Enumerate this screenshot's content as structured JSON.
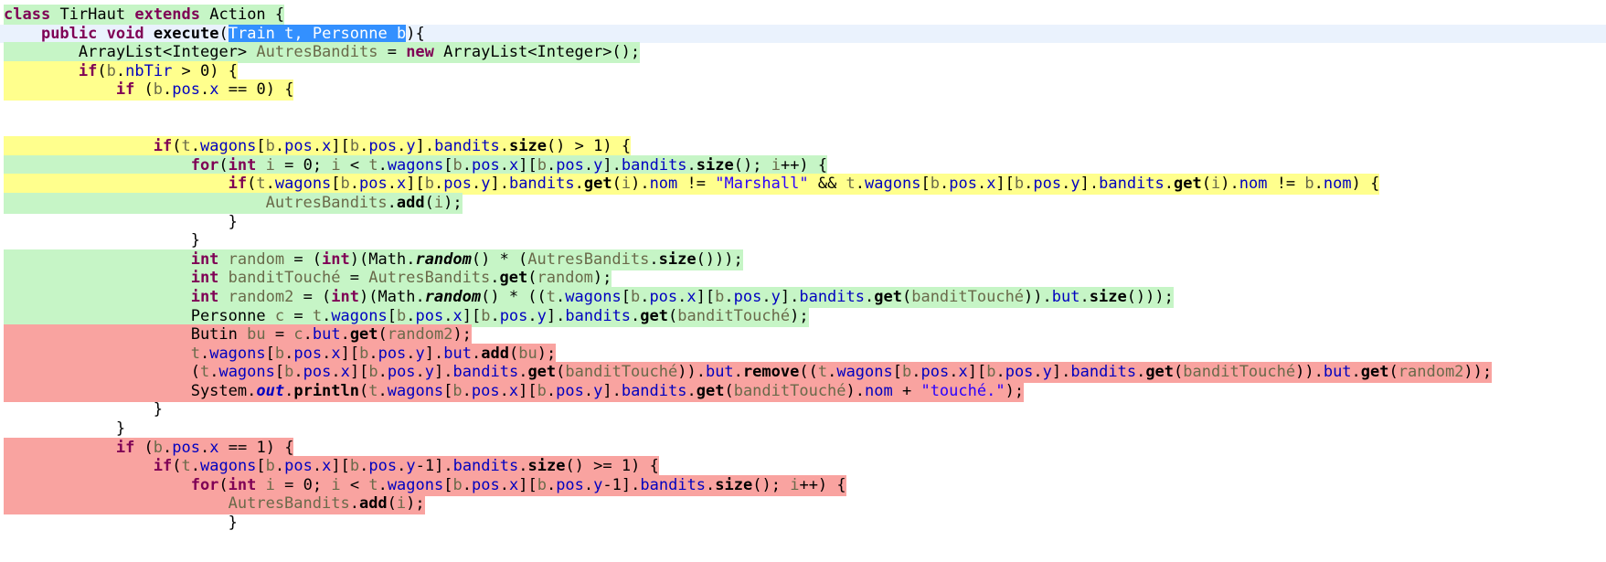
{
  "editor": {
    "language": "java",
    "font_size_px": 17,
    "line_height_px": 20.6,
    "background": "#ffffff",
    "colors": {
      "keyword": "#7f0055",
      "string": "#2a00ff",
      "field": "#0000c0",
      "method": "#000000",
      "identifier": "#6a6a4a",
      "plain": "#000000",
      "selection_bg": "#3390ff",
      "selection_fg": "#ffffff",
      "current_line_bg": "#eaf2fd",
      "coverage_full": "#c6f5c6",
      "coverage_partial": "#ffff8d",
      "coverage_none": "#f9a3a0"
    },
    "selection_text": "Train t, Personne b"
  },
  "code": {
    "class_name": "TirHaut",
    "super_class": "Action",
    "method_name": "execute",
    "lines": [
      {
        "n": 1,
        "indent": 0,
        "highlight": "green",
        "text": "class TirHaut extends Action {"
      },
      {
        "n": 2,
        "indent": 1,
        "highlight": "none",
        "current": true,
        "text": "public void execute(Train t, Personne b){"
      },
      {
        "n": 3,
        "indent": 2,
        "highlight": "green",
        "text": "ArrayList<Integer> AutresBandits = new ArrayList<Integer>();"
      },
      {
        "n": 4,
        "indent": 2,
        "highlight": "yellow",
        "text": "if(b.nbTir > 0) {"
      },
      {
        "n": 5,
        "indent": 3,
        "highlight": "yellow",
        "text": "if (b.pos.x == 0) {"
      },
      {
        "n": 6,
        "indent": 0,
        "highlight": "none",
        "text": ""
      },
      {
        "n": 7,
        "indent": 0,
        "highlight": "none",
        "text": ""
      },
      {
        "n": 8,
        "indent": 4,
        "highlight": "yellow",
        "text": "if(t.wagons[b.pos.x][b.pos.y].bandits.size() > 1) {"
      },
      {
        "n": 9,
        "indent": 5,
        "highlight": "green",
        "text": "for(int i = 0; i < t.wagons[b.pos.x][b.pos.y].bandits.size(); i++) {"
      },
      {
        "n": 10,
        "indent": 6,
        "highlight": "yellow",
        "text": "if(t.wagons[b.pos.x][b.pos.y].bandits.get(i).nom != \"Marshall\" && t.wagons[b.pos.x][b.pos.y].bandits.get(i).nom != b.nom) {"
      },
      {
        "n": 11,
        "indent": 7,
        "highlight": "green",
        "text": "AutresBandits.add(i);"
      },
      {
        "n": 12,
        "indent": 6,
        "highlight": "none",
        "text": "}"
      },
      {
        "n": 13,
        "indent": 5,
        "highlight": "none",
        "text": "}"
      },
      {
        "n": 14,
        "indent": 5,
        "highlight": "green",
        "text": "int random = (int)(Math.random() * (AutresBandits.size()));"
      },
      {
        "n": 15,
        "indent": 5,
        "highlight": "green",
        "text": "int banditTouché = AutresBandits.get(random);"
      },
      {
        "n": 16,
        "indent": 5,
        "highlight": "green",
        "text": "int random2 = (int)(Math.random() * ((t.wagons[b.pos.x][b.pos.y].bandits.get(banditTouché)).but.size()));"
      },
      {
        "n": 17,
        "indent": 5,
        "highlight": "green",
        "text": "Personne c = t.wagons[b.pos.x][b.pos.y].bandits.get(banditTouché);"
      },
      {
        "n": 18,
        "indent": 5,
        "highlight": "red",
        "text": "Butin bu = c.but.get(random2);"
      },
      {
        "n": 19,
        "indent": 5,
        "highlight": "red",
        "text": "t.wagons[b.pos.x][b.pos.y].but.add(bu);"
      },
      {
        "n": 20,
        "indent": 5,
        "highlight": "red",
        "text": "(t.wagons[b.pos.x][b.pos.y].bandits.get(banditTouché)).but.remove((t.wagons[b.pos.x][b.pos.y].bandits.get(banditTouché)).but.get(random2));"
      },
      {
        "n": 21,
        "indent": 5,
        "highlight": "red",
        "text": "System.out.println(t.wagons[b.pos.x][b.pos.y].bandits.get(banditTouché).nom + \"touché.\");"
      },
      {
        "n": 22,
        "indent": 4,
        "highlight": "none",
        "text": "}"
      },
      {
        "n": 23,
        "indent": 3,
        "highlight": "none",
        "text": "}"
      },
      {
        "n": 24,
        "indent": 3,
        "highlight": "red",
        "text": "if (b.pos.x == 1) {"
      },
      {
        "n": 25,
        "indent": 4,
        "highlight": "red",
        "text": "if(t.wagons[b.pos.x][b.pos.y-1].bandits.size() >= 1) {"
      },
      {
        "n": 26,
        "indent": 5,
        "highlight": "red",
        "text": "for(int i = 0; i < t.wagons[b.pos.x][b.pos.y-1].bandits.size(); i++) {"
      },
      {
        "n": 27,
        "indent": 6,
        "highlight": "red",
        "text": "AutresBandits.add(i);"
      },
      {
        "n": 28,
        "indent": 6,
        "highlight": "none",
        "text": "}"
      }
    ]
  }
}
